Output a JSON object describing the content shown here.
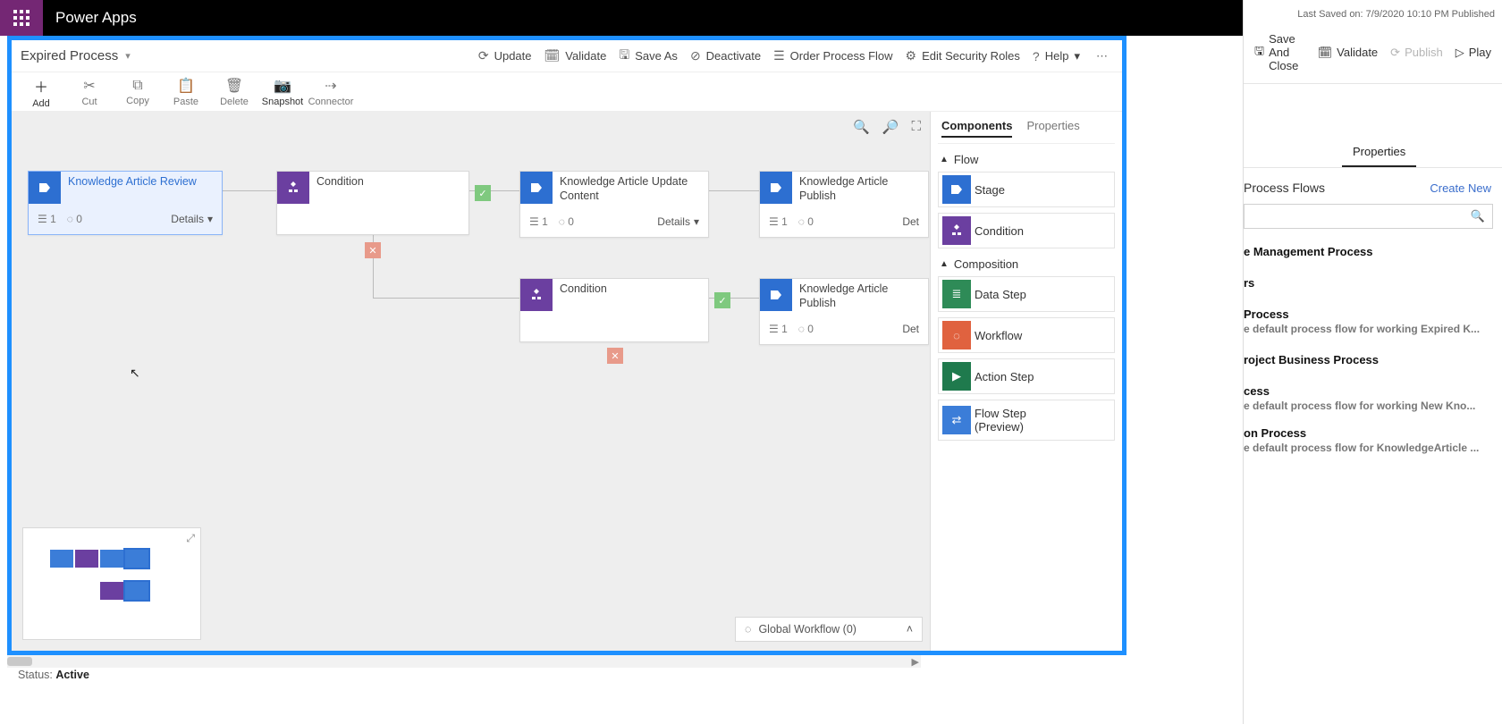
{
  "app": {
    "title": "Power Apps"
  },
  "right_strip": {
    "last_saved": "Last Saved on: 7/9/2020 10:10 PM Published",
    "cmds": {
      "save_close": "Save And Close",
      "validate": "Validate",
      "publish": "Publish",
      "play": "Play"
    },
    "tabs": {
      "properties": "Properties"
    },
    "section_title": "Process Flows",
    "create_new": "Create New",
    "items": [
      {
        "title": "e Management Process",
        "sub": ""
      },
      {
        "title": "rs",
        "sub": ""
      },
      {
        "title": "Process",
        "sub": "e default process flow for working Expired K..."
      },
      {
        "title": "roject Business Process",
        "sub": ""
      },
      {
        "title": "cess",
        "sub": "e default process flow for working New Kno..."
      },
      {
        "title": "on Process",
        "sub": "e default process flow for KnowledgeArticle ..."
      }
    ]
  },
  "header": {
    "title": "Expired Process",
    "actions": {
      "update": "Update",
      "validate": "Validate",
      "save_as": "Save As",
      "deactivate": "Deactivate",
      "order": "Order Process Flow",
      "security": "Edit Security Roles",
      "help": "Help"
    }
  },
  "toolbar": {
    "add": "Add",
    "cut": "Cut",
    "copy": "Copy",
    "paste": "Paste",
    "delete": "Delete",
    "snapshot": "Snapshot",
    "connector": "Connector"
  },
  "cards": {
    "c1": {
      "title": "Knowledge Article Review",
      "steps": "1",
      "workflows": "0",
      "details": "Details"
    },
    "c2": {
      "title": "Condition"
    },
    "c3": {
      "title": "Knowledge Article Update Content",
      "steps": "1",
      "workflows": "0",
      "details": "Details"
    },
    "c4": {
      "title": "Knowledge Article Publish",
      "steps": "1",
      "workflows": "0",
      "details": "Det"
    },
    "c5": {
      "title": "Condition"
    },
    "c6": {
      "title": "Knowledge Article Publish",
      "steps": "1",
      "workflows": "0",
      "details": "Det"
    }
  },
  "components": {
    "tabs": {
      "components": "Components",
      "properties": "Properties"
    },
    "groups": {
      "flow": {
        "title": "Flow",
        "items": {
          "stage": "Stage",
          "condition": "Condition"
        }
      },
      "composition": {
        "title": "Composition",
        "items": {
          "data_step": "Data Step",
          "workflow": "Workflow",
          "action_step": "Action Step",
          "flow_step": "Flow Step\n(Preview)"
        }
      }
    }
  },
  "global_workflow": "Global Workflow (0)",
  "status": {
    "label": "Status:",
    "value": "Active"
  }
}
